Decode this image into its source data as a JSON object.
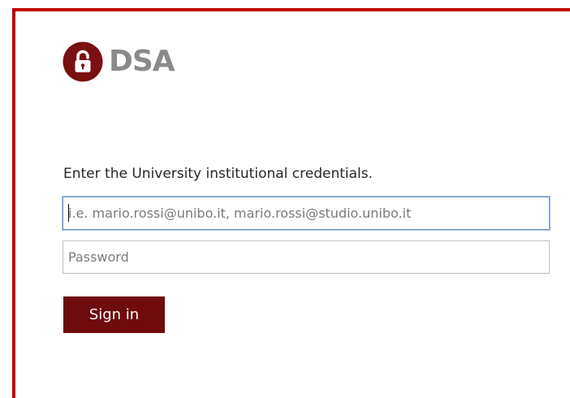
{
  "logo": {
    "icon": "padlock-icon",
    "text": "DSA",
    "mark_color": "#7a1012",
    "text_color": "#8a8a8a"
  },
  "form": {
    "prompt": "Enter the University institutional credentials.",
    "email_placeholder": "i.e. mario.rossi@unibo.it, mario.rossi@studio.unibo.it",
    "password_placeholder": "Password",
    "sign_in_label": "Sign in"
  },
  "colors": {
    "frame_border": "#c00000",
    "button_bg": "#6e0b0d",
    "focus_border": "#6c93c8"
  }
}
